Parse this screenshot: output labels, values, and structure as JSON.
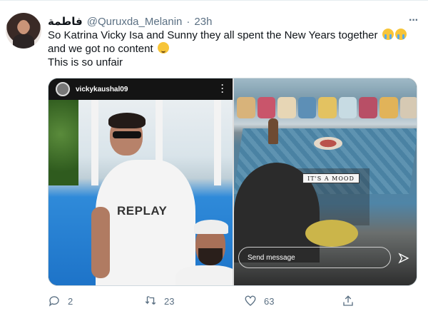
{
  "tweet": {
    "display_name": "فاطمة",
    "handle": "@Quruxda_Melanin",
    "separator": "·",
    "time": "23h",
    "more_icon": "more-icon",
    "lines": [
      "So Katrina Vicky Isa and Sunny they all spent the New Years together",
      "and we got no content",
      "This is so unfair"
    ],
    "emoji": [
      "loudly-crying-face",
      "loudly-crying-face",
      "relieved-face"
    ]
  },
  "media": {
    "left": {
      "username": "vickykaushal09",
      "shirt_text": "REPLAY"
    },
    "right": {
      "sticker_text": "IT'S A MOOD",
      "send_placeholder": "Send message"
    }
  },
  "actions": {
    "replies": "2",
    "retweets": "23",
    "likes": "63",
    "share_icon": "share-icon"
  },
  "colors": {
    "secondary_text": "#5b7083",
    "primary_text": "#0f1419",
    "border": "#cfd9de"
  }
}
